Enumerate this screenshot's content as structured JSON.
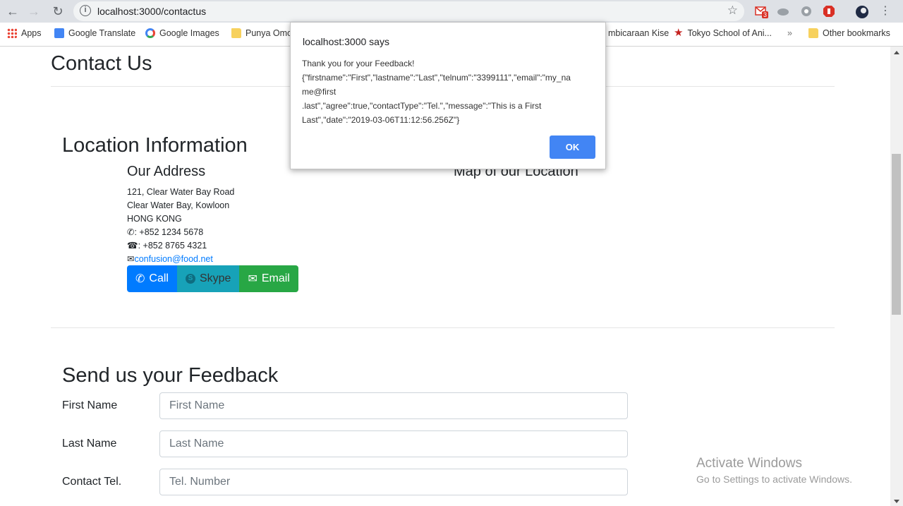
{
  "browser": {
    "url": "localhost:3000/contactus",
    "bookmarks": [
      "Apps",
      "Google Translate",
      "Google Images",
      "Punya Omo",
      "mbicaraan Kise",
      "Tokyo School of Ani...",
      "Other bookmarks"
    ],
    "gmail_badge": "3",
    "more_bookmarks": "»"
  },
  "page": {
    "title": "Contact Us",
    "location_title": "Location Information",
    "address_title": "Our Address",
    "map_title": "Map of our Location",
    "address_lines": [
      "121, Clear Water Bay Road",
      "Clear Water Bay, Kowloon",
      "HONG KONG"
    ],
    "phone": ": +852 1234 5678",
    "fax": ": +852 8765 4321",
    "email": "confusion@food.net",
    "buttons": {
      "call": "Call",
      "skype": "Skype",
      "email": "Email"
    },
    "feedback_title": "Send us your Feedback",
    "form": {
      "firstname_label": "First Name",
      "firstname_placeholder": "First Name",
      "lastname_label": "Last Name",
      "lastname_placeholder": "Last Name",
      "tel_label": "Contact Tel.",
      "tel_placeholder": "Tel. Number"
    },
    "watermark": {
      "line1": "Activate Windows",
      "line2": "Go to Settings to activate Windows."
    }
  },
  "dialog": {
    "title": "localhost:3000 says",
    "message_lines": [
      "Thank you for your Feedback!",
      "{\"firstname\":\"First\",\"lastname\":\"Last\",\"telnum\":\"3399111\",\"email\":\"my_na",
      "me@first",
      ".last\",\"agree\":true,\"contactType\":\"Tel.\",\"message\":\"This is a First",
      "Last\",\"date\":\"2019-03-06T11:12:56.256Z\"}"
    ],
    "ok": "OK"
  }
}
